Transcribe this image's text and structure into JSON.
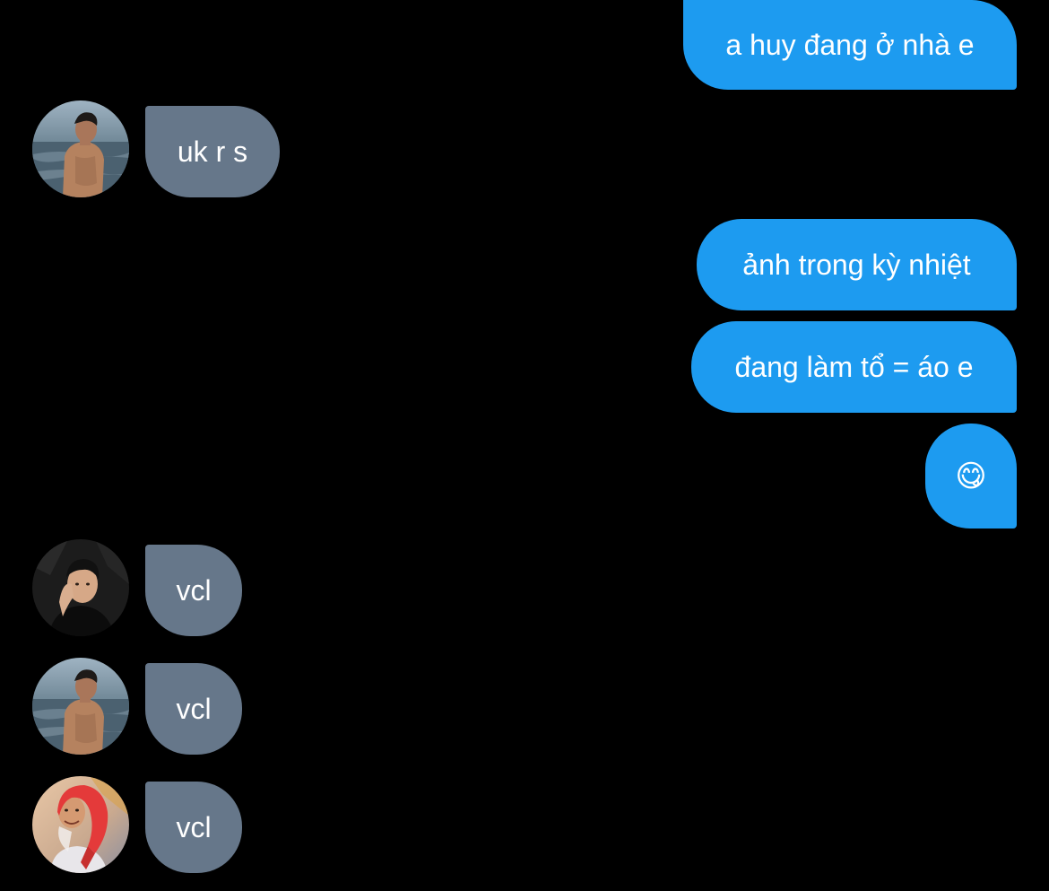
{
  "messages": [
    {
      "direction": "outgoing",
      "text": "a huy đang ở nhà e"
    },
    {
      "direction": "incoming",
      "sender": "beach-avatar",
      "text": "uk r s"
    },
    {
      "direction": "outgoing",
      "text": "ảnh trong kỳ nhiệt"
    },
    {
      "direction": "outgoing",
      "text": "đang làm tổ = áo e"
    },
    {
      "direction": "outgoing",
      "emoji": "😋",
      "icon": "yum-face-emoji-icon"
    },
    {
      "direction": "incoming",
      "sender": "dark-portrait-avatar",
      "text": "vcl"
    },
    {
      "direction": "incoming",
      "sender": "beach-avatar",
      "text": "vcl"
    },
    {
      "direction": "incoming",
      "sender": "red-hood-avatar",
      "text": "vcl"
    }
  ],
  "colors": {
    "background": "#000000",
    "outgoing_bubble": "#1d9bf0",
    "incoming_bubble": "#66778a",
    "text": "#ffffff"
  }
}
